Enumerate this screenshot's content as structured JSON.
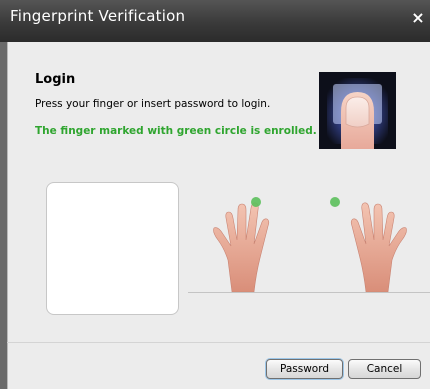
{
  "window": {
    "title": "Fingerprint Verification",
    "close_glyph": "×"
  },
  "login": {
    "heading": "Login",
    "instruction": "Press your finger or insert password to login.",
    "enrolled_note": "The finger marked with green circle is enrolled."
  },
  "icons": {
    "logo": "fingerprint-logo-icon",
    "hands": "two-hands-icon",
    "enrolled_marker_color": "#5cc05c"
  },
  "buttons": {
    "password": "Password",
    "cancel": "Cancel"
  },
  "colors": {
    "enrolled_text": "#2fa52f",
    "titlebar": "#3a3a3a"
  }
}
